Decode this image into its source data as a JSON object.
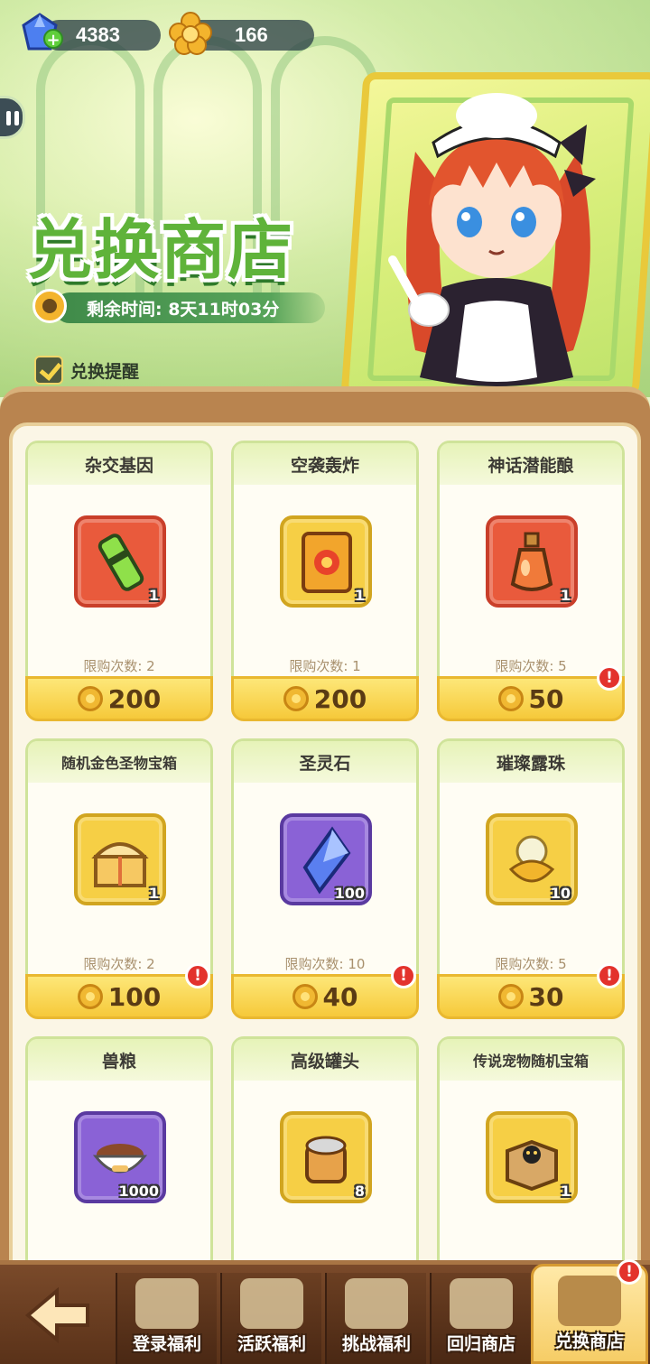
{
  "currency": {
    "gems": "4383",
    "gold": "166"
  },
  "header": {
    "title": "兑换商店",
    "timer": "剩余时间: 8天11时03分",
    "reminder_label": "兑换提醒"
  },
  "items": [
    {
      "name": "杂交基因",
      "qty": "1",
      "limit": "限购次数: 2",
      "price": "200",
      "frame": "red",
      "alert": false,
      "icon": "gene-capsule-icon"
    },
    {
      "name": "空袭轰炸",
      "qty": "1",
      "limit": "限购次数: 1",
      "price": "200",
      "frame": "gold",
      "alert": false,
      "icon": "airstrike-card-icon"
    },
    {
      "name": "神话潜能酿",
      "qty": "1",
      "limit": "限购次数: 5",
      "price": "50",
      "frame": "red",
      "alert": true,
      "icon": "potion-bottle-icon"
    },
    {
      "name": "随机金色圣物宝箱",
      "qty": "1",
      "limit": "限购次数: 2",
      "price": "100",
      "frame": "gold",
      "alert": true,
      "icon": "golden-chest-icon"
    },
    {
      "name": "圣灵石",
      "qty": "100",
      "limit": "限购次数: 10",
      "price": "40",
      "frame": "purple",
      "alert": true,
      "icon": "crystal-icon"
    },
    {
      "name": "璀璨露珠",
      "qty": "10",
      "limit": "限购次数: 5",
      "price": "30",
      "frame": "gold",
      "alert": true,
      "icon": "dew-flower-icon"
    },
    {
      "name": "兽粮",
      "qty": "1000",
      "limit": "",
      "price": "",
      "frame": "purple",
      "alert": false,
      "icon": "pet-food-bowl-icon"
    },
    {
      "name": "高级罐头",
      "qty": "8",
      "limit": "",
      "price": "",
      "frame": "gold",
      "alert": false,
      "icon": "canned-food-icon"
    },
    {
      "name": "传说宠物随机宝箱",
      "qty": "1",
      "limit": "",
      "price": "",
      "frame": "gold",
      "alert": false,
      "icon": "pet-box-icon"
    }
  ],
  "nav": {
    "tabs": [
      {
        "label": "登录福利"
      },
      {
        "label": "活跃福利"
      },
      {
        "label": "挑战福利"
      },
      {
        "label": "回归商店"
      },
      {
        "label": "兑换商店"
      }
    ],
    "active_tab_alert": "!"
  },
  "colors": {
    "title_green": "#5fb33a",
    "price_yellow": "#f6c93a",
    "alert_red": "#e3322c"
  }
}
